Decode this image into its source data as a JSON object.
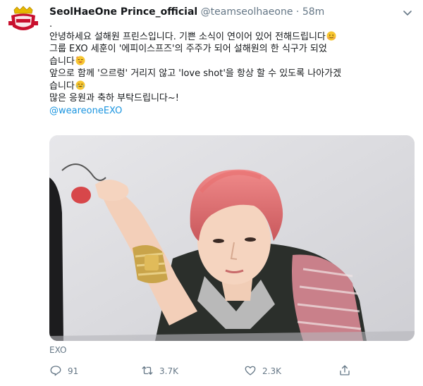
{
  "tweet": {
    "display_name": "SeolHaeOne Prince_official",
    "handle": "@teamseolhaeone",
    "separator": "·",
    "time": "58m",
    "lines": [
      ".",
      "안녕하세요 설해원 프린스입니다. 기쁜 소식이 연이어 있어 전해드립니다",
      "그룹 EXO 세훈이 '에피이스프즈'의 주주가 되어 설해원의 한 식구가 되었",
      "습니다",
      "앞으로 함께 '으르렁' 거리지 않고 'love shot'을 항상 할 수 있도록 나아가겠",
      "습니다",
      "많은 응원과 축하 부탁드립니다~!"
    ],
    "mention": "@weareoneEXO",
    "photo_tag": "EXO"
  },
  "actions": {
    "reply_count": "91",
    "retweet_count": "3.7K",
    "like_count": "2.3K"
  },
  "icons": {
    "caret": "chevron-down-icon",
    "reply": "reply-icon",
    "retweet": "retweet-icon",
    "like": "heart-icon",
    "share": "share-icon",
    "emoji": "emoji-icon"
  },
  "colors": {
    "link": "#1b95e0",
    "secondary_text": "#657786",
    "primary_text": "#14171a"
  }
}
